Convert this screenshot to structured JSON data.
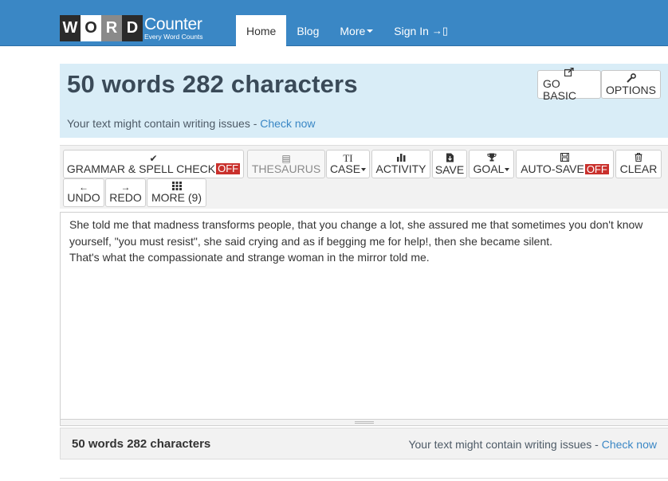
{
  "brand": {
    "letters": [
      "W",
      "O",
      "R",
      "D"
    ],
    "name": "Counter",
    "tagline": "Every Word Counts"
  },
  "nav": {
    "items": [
      {
        "label": "Home"
      },
      {
        "label": "Blog"
      },
      {
        "label": "More"
      },
      {
        "label": "Sign In"
      }
    ]
  },
  "banner": {
    "stats": "50 words 282 characters",
    "issue_text": "Your text might contain writing issues - ",
    "issue_link": "Check now",
    "go_basic": "GO BASIC",
    "options": "OPTIONS"
  },
  "toolbar": {
    "grammar": "GRAMMAR & SPELL CHECK",
    "grammar_state": "OFF",
    "thesaurus": "THESAURUS",
    "case_icon": "TI",
    "case": "CASE",
    "activity": "ACTIVITY",
    "save": "SAVE",
    "goal": "GOAL",
    "autosave": "AUTO-SAVE",
    "autosave_state": "OFF",
    "clear": "CLEAR",
    "undo": "UNDO",
    "redo": "REDO",
    "more": "MORE (9)"
  },
  "editor": {
    "lines": [
      "She told me that madness transforms people, that you change a lot, she assured me that sometimes you don't know",
      "yourself, \"you must resist\", she said crying and as if begging me for help!, then she became silent.",
      "That's what the compassionate and strange woman in the mirror told me."
    ]
  },
  "footer": {
    "stats": "50 words 282 characters",
    "issue_text": "Your text might contain writing issues - ",
    "issue_link": "Check now"
  },
  "colors": {
    "navbar": "#3a87c5",
    "banner": "#d9edf7",
    "off_badge": "#c9302c",
    "link": "#3a87c5"
  }
}
